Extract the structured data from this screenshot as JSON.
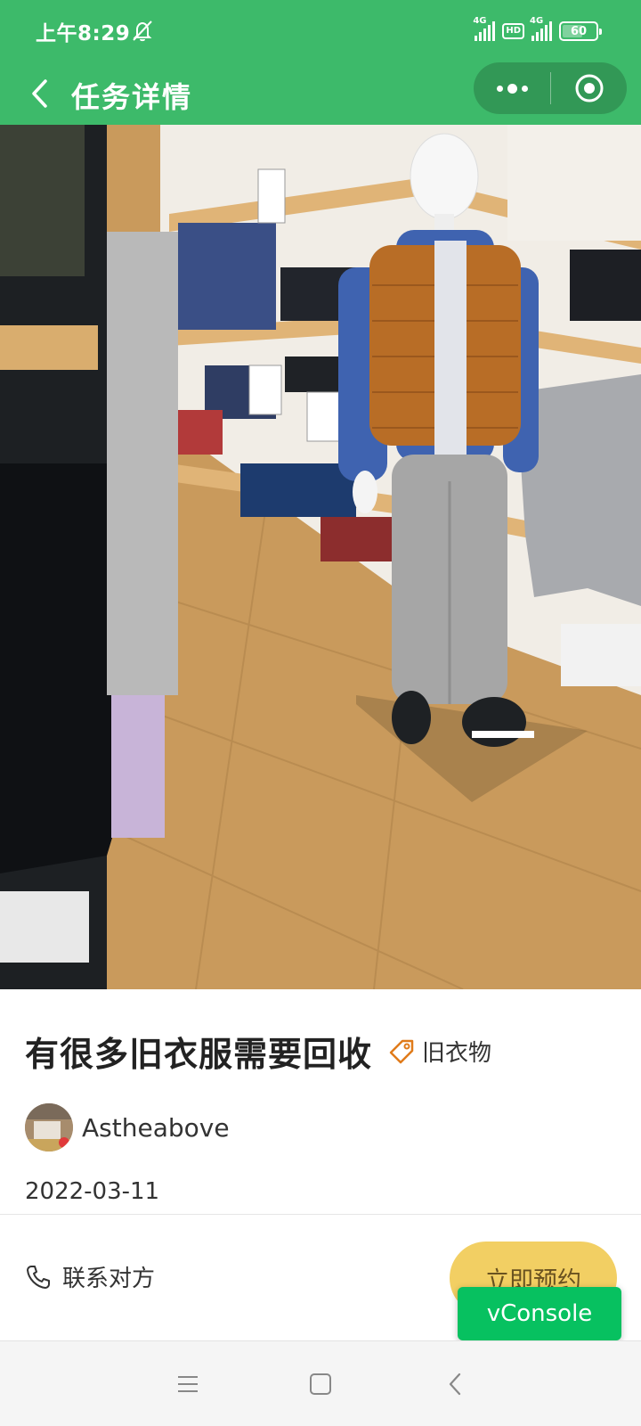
{
  "status_bar": {
    "time": "上午8:29",
    "signal1_label": "4G",
    "hd_label": "HD",
    "signal2_label": "4G",
    "battery": "60",
    "battery_level": 0.6,
    "icons": [
      "alarm-off-icon",
      "signal-icon",
      "hd-icon",
      "signal-icon",
      "battery-icon"
    ]
  },
  "nav": {
    "title": "任务详情",
    "back_icon": "chevron-left-icon",
    "more_icon": "more-dots-icon",
    "close_icon": "target-close-icon"
  },
  "task": {
    "title": "有很多旧衣服需要回收",
    "tag_icon": "tag-icon",
    "tag": "旧衣物",
    "user": {
      "name": "Astheabove"
    },
    "date": "2022-03-11"
  },
  "actions": {
    "contact_label": "联系对方",
    "contact_icon": "phone-icon",
    "book_label": "立即预约"
  },
  "vconsole": {
    "label": "vConsole"
  },
  "system_nav": [
    "menu-icon",
    "home-icon",
    "back-icon"
  ],
  "colors": {
    "brand_green": "#3dba6a",
    "book_button": "#f2cf63",
    "vconsole_green": "#07c160",
    "tag_orange": "#e07b1a"
  }
}
